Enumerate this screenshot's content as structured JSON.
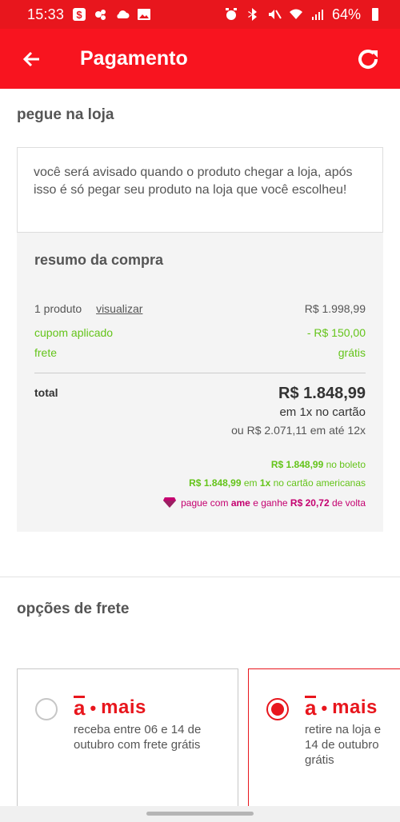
{
  "status_bar": {
    "time": "15:33",
    "battery": "64%"
  },
  "app_bar": {
    "title": "Pagamento"
  },
  "pickup": {
    "title": "pegue na loja",
    "notice": "você será avisado quando o produto chegar a loja, após isso é só pegar seu produto na loja que você escolheu!"
  },
  "summary": {
    "title": "resumo da compra",
    "products_label": "1 produto",
    "view_link": "visualizar",
    "products_value": "R$ 1.998,99",
    "coupon_label": "cupom aplicado",
    "coupon_value": "- R$ 150,00",
    "shipping_label": "frete",
    "shipping_value": "grátis",
    "total_label": "total",
    "total_value": "R$ 1.848,99",
    "card_1x": "em 1x no cartão",
    "installments": "ou R$ 2.071,11 em até 12x",
    "boleto_value": "R$ 1.848,99",
    "boleto_text": "no boleto",
    "amcard_value": "R$ 1.848,99",
    "amcard_em": "em",
    "amcard_1x": "1x",
    "amcard_text": "no cartão americanas",
    "ame_prefix": "pague com",
    "ame_brand": "ame",
    "ame_mid": "e ganhe",
    "ame_value": "R$ 20,72",
    "ame_suffix": "de volta"
  },
  "shipping_options": {
    "title": "opções de frete",
    "options": [
      {
        "brand_a": "a",
        "brand_mais": "mais",
        "description": "receba entre 06 e 14 de outubro com frete grátis",
        "selected": false
      },
      {
        "brand_a": "a",
        "brand_mais": "mais",
        "description": "retire na loja e 14 de outubro grátis",
        "selected": true
      }
    ]
  },
  "colors": {
    "brand_red": "#e8161d",
    "green": "#64c41a",
    "ame_pink": "#c4006f"
  }
}
